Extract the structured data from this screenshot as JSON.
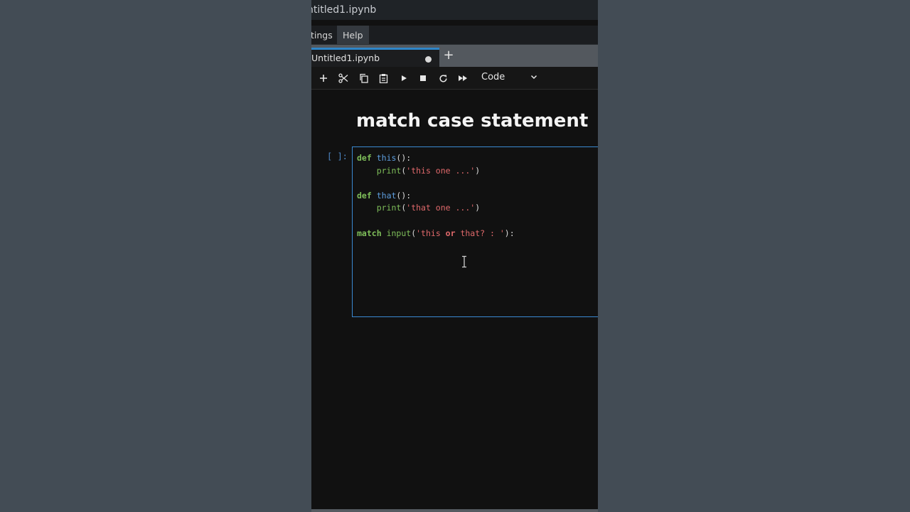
{
  "window": {
    "title": "ntitled1.ipynb"
  },
  "menubar": {
    "items": [
      "tings",
      "Help"
    ]
  },
  "tabbar": {
    "tab_title": "Untitled1.ipynb",
    "new_tab": "+"
  },
  "toolbar": {
    "buttons": [
      "plus-icon",
      "scissors-icon",
      "copy-icon",
      "paste-icon",
      "run-icon",
      "stop-icon",
      "restart-icon",
      "fast-forward-icon"
    ],
    "cell_type": "Code"
  },
  "notebook": {
    "heading": "match case statement",
    "cell": {
      "prompt": "[ ]:",
      "lines": [
        [
          "def",
          " ",
          "this",
          "():"
        ],
        [
          "    ",
          "print",
          "(",
          "'this one ...'",
          ")"
        ],
        [
          ""
        ],
        [
          "def",
          " ",
          "that",
          "():"
        ],
        [
          "    ",
          "print",
          "(",
          "'that one ...'",
          ")"
        ],
        [
          ""
        ],
        [
          "match",
          " ",
          "input",
          "(",
          "'this ",
          "or",
          " that? : '",
          "):"
        ]
      ]
    }
  },
  "colors": {
    "accent": "#3b8ad3",
    "keyword": "#7fbf5a",
    "function_name": "#5e9fe0",
    "string": "#e0696b",
    "background": "#111111",
    "outer_background": "#434c55"
  }
}
